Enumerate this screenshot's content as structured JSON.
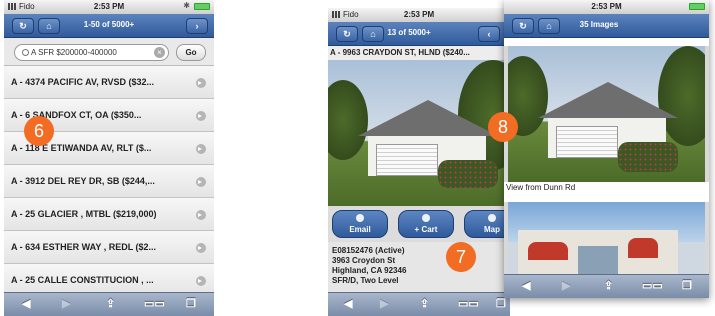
{
  "colors": {
    "accent": "#2f5a9b",
    "badge": "#f26c23"
  },
  "phone1": {
    "status": {
      "carrier": "Fido",
      "time": "2:53 PM"
    },
    "nav": {
      "back_icon": "refresh-icon",
      "home_icon": "home-icon",
      "title": "1-50 of 5000+",
      "next_icon": "chevron-right-icon"
    },
    "search": {
      "value": "A SFR $200000-400000",
      "go": "Go"
    },
    "rows": [
      "A - 4374 PACIFIC AV, RVSD ($32...",
      "A - 6 SANDFOX CT, OA ($350...",
      "A - 118 E ETIWANDA AV, RLT ($...",
      "A - 3912 DEL REY DR, SB ($244,...",
      "A - 25 GLACIER , MTBL ($219,000)",
      "A - 634 ESTHER WAY , REDL ($2...",
      "A - 25 CALLE CONSTITUCION , ..."
    ],
    "badge": "6"
  },
  "phone2": {
    "status": {
      "carrier": "Fido",
      "time": "2:53 PM"
    },
    "nav": {
      "title": "13 of 5000+"
    },
    "address": "A - 9963 CRAYDON ST, HLND ($240...",
    "buttons": {
      "email": "Email",
      "cart": "+ Cart",
      "map": "Map"
    },
    "details": [
      "E08152476 (Active)",
      "3963 Croydon St",
      "Highland, CA 92346",
      "SFR/D, Two Level"
    ],
    "badge": "7"
  },
  "phone3": {
    "status": {
      "time": "2:53 PM"
    },
    "nav": {
      "title": "35 Images"
    },
    "caption": "View from Dunn Rd",
    "badge": "8"
  }
}
